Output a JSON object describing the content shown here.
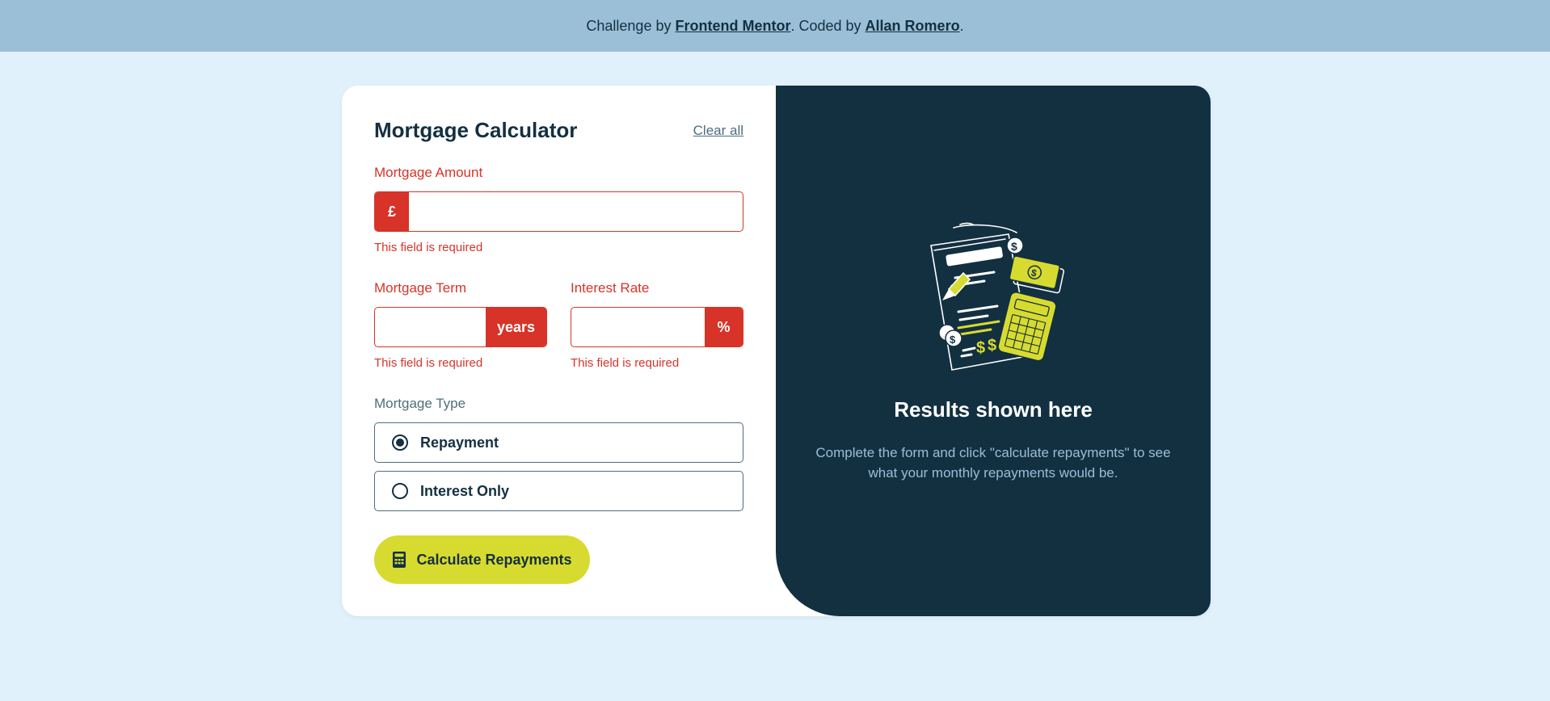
{
  "attribution": {
    "prefix": "Challenge by ",
    "challenge_link": "Frontend Mentor",
    "middle": ". Coded by ",
    "author_link": "Allan Romero",
    "suffix": "."
  },
  "form": {
    "title": "Mortgage Calculator",
    "clear_all": "Clear all",
    "amount": {
      "label": "Mortgage Amount",
      "prefix": "£",
      "value": "",
      "error": "This field is required"
    },
    "term": {
      "label": "Mortgage Term",
      "suffix": "years",
      "value": "",
      "error": "This field is required"
    },
    "rate": {
      "label": "Interest Rate",
      "suffix": "%",
      "value": "",
      "error": "This field is required"
    },
    "type": {
      "label": "Mortgage Type",
      "options": [
        {
          "label": "Repayment",
          "selected": true
        },
        {
          "label": "Interest Only",
          "selected": false
        }
      ]
    },
    "submit_label": "Calculate Repayments"
  },
  "results": {
    "title": "Results shown here",
    "description": "Complete the form and click \"calculate repayments\" to see what your monthly repayments would be."
  },
  "colors": {
    "background": "#e0f1fb",
    "banner": "#9bbfd7",
    "dark": "#133041",
    "accent": "#d8db2f",
    "error": "#d73328",
    "slate": "#4e6e7e"
  },
  "icons": {
    "calculator": "calculator-icon",
    "radio_selected": "radio-selected-icon",
    "radio_unselected": "radio-unselected-icon",
    "illustration": "empty-results-illustration"
  }
}
